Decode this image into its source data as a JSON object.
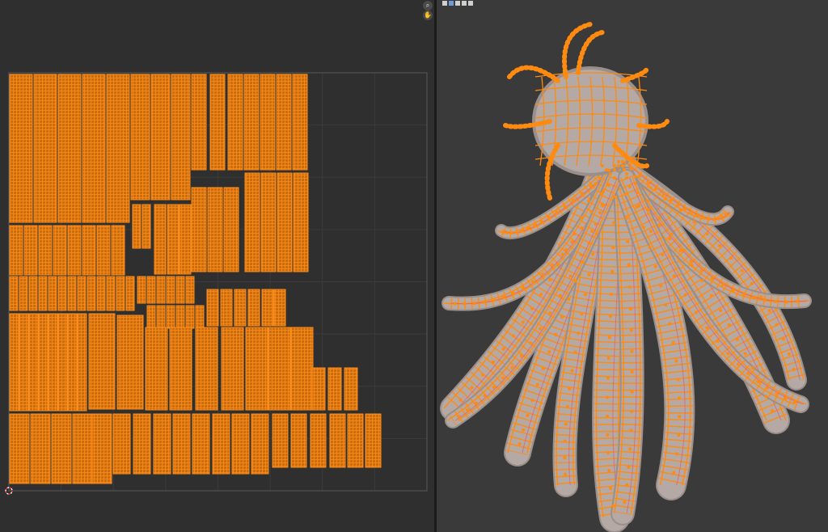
{
  "uv_editor": {
    "grid_color": "#3b3b3b",
    "bounds_color": "#5a5a5a",
    "island_fill": "#c96d0e",
    "island_edge": "#ff8d1a",
    "cursor_icon": "2d-cursor-icon"
  },
  "viewport": {
    "background": "#3a3a3a",
    "hair_fill": "#b4a9a4",
    "wire_color": "#ff8a10",
    "seam_color": "#e0527a",
    "nav": {
      "zoom_icon": "magnifier-icon",
      "pan_icon": "hand-icon"
    },
    "header_icon_names": [
      "mode-icon",
      "solid-shading-icon",
      "material-icon",
      "render-icon",
      "wireframe-icon"
    ]
  }
}
